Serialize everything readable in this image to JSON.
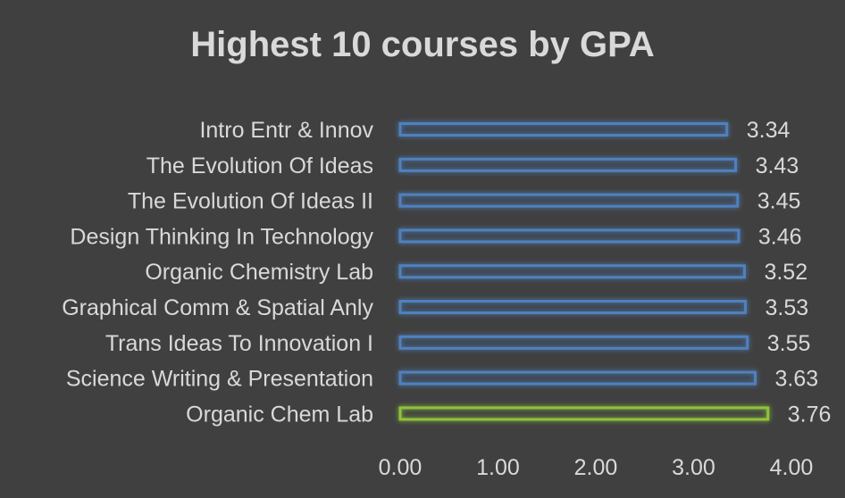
{
  "chart_data": {
    "type": "bar",
    "orientation": "horizontal",
    "title": "Highest 10 courses by GPA",
    "categories": [
      "Intro Entr & Innov",
      "The Evolution Of Ideas",
      "The Evolution Of Ideas II",
      "Design Thinking In Technology",
      "Organic Chemistry Lab",
      "Graphical Comm & Spatial Anly",
      "Trans Ideas To Innovation I",
      "Science Writing & Presentation",
      "Organic Chem Lab"
    ],
    "values": [
      3.34,
      3.43,
      3.45,
      3.46,
      3.52,
      3.53,
      3.55,
      3.63,
      3.76
    ],
    "value_labels": [
      "3.34",
      "3.43",
      "3.45",
      "3.46",
      "3.52",
      "3.53",
      "3.55",
      "3.63",
      "3.76"
    ],
    "x_ticks": [
      "0.00",
      "1.00",
      "2.00",
      "3.00",
      "4.00"
    ],
    "xlim": [
      0,
      4
    ],
    "grid": false,
    "colors": {
      "background": "#404040",
      "text": "#d9d9d9",
      "bar_outline": "#4f81bd",
      "highlight_outline": "#8fc33a"
    },
    "highlight_category": "Organic Chem Lab"
  }
}
